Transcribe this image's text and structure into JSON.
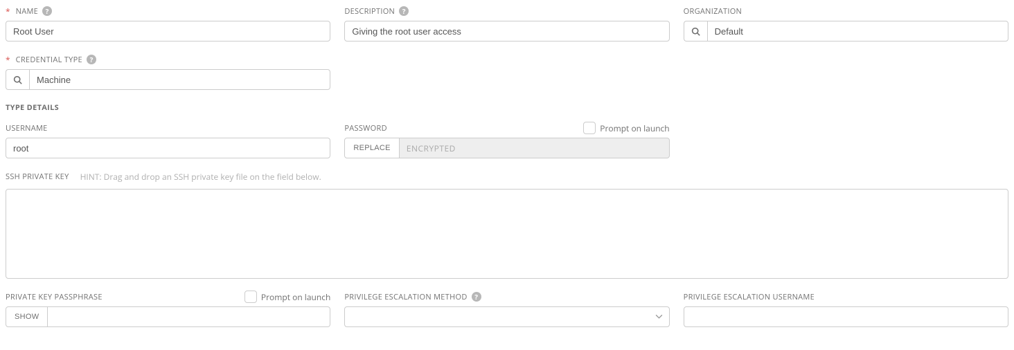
{
  "labels": {
    "name": "NAME",
    "description": "DESCRIPTION",
    "organization": "ORGANIZATION",
    "credential_type": "CREDENTIAL TYPE",
    "type_details": "TYPE DETAILS",
    "username": "USERNAME",
    "password": "PASSWORD",
    "prompt_on_launch": "Prompt on launch",
    "ssh_private_key": "SSH PRIVATE KEY",
    "ssh_hint": "HINT: Drag and drop an SSH private key file on the field below.",
    "private_key_passphrase": "PRIVATE KEY PASSPHRASE",
    "privilege_escalation_method": "PRIVILEGE ESCALATION METHOD",
    "privilege_escalation_username": "PRIVILEGE ESCALATION USERNAME",
    "replace": "REPLACE",
    "encrypted": "ENCRYPTED",
    "show": "SHOW",
    "required_marker": "*"
  },
  "values": {
    "name": "Root User",
    "description": "Giving the root user access",
    "organization": "Default",
    "credential_type": "Machine",
    "username": "root",
    "ssh_private_key": "",
    "private_key_passphrase": "",
    "privilege_escalation_method": "",
    "privilege_escalation_username": ""
  }
}
